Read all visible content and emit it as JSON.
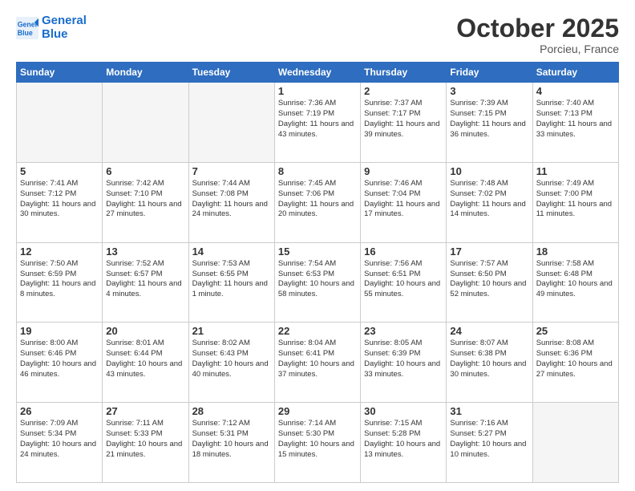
{
  "header": {
    "logo_general": "General",
    "logo_blue": "Blue",
    "month": "October 2025",
    "location": "Porcieu, France"
  },
  "weekdays": [
    "Sunday",
    "Monday",
    "Tuesday",
    "Wednesday",
    "Thursday",
    "Friday",
    "Saturday"
  ],
  "weeks": [
    [
      {
        "day": "",
        "empty": true
      },
      {
        "day": "",
        "empty": true
      },
      {
        "day": "",
        "empty": true
      },
      {
        "day": "1",
        "sunrise": "7:36 AM",
        "sunset": "7:19 PM",
        "daylight": "11 hours and 43 minutes."
      },
      {
        "day": "2",
        "sunrise": "7:37 AM",
        "sunset": "7:17 PM",
        "daylight": "11 hours and 39 minutes."
      },
      {
        "day": "3",
        "sunrise": "7:39 AM",
        "sunset": "7:15 PM",
        "daylight": "11 hours and 36 minutes."
      },
      {
        "day": "4",
        "sunrise": "7:40 AM",
        "sunset": "7:13 PM",
        "daylight": "11 hours and 33 minutes."
      }
    ],
    [
      {
        "day": "5",
        "sunrise": "7:41 AM",
        "sunset": "7:12 PM",
        "daylight": "11 hours and 30 minutes."
      },
      {
        "day": "6",
        "sunrise": "7:42 AM",
        "sunset": "7:10 PM",
        "daylight": "11 hours and 27 minutes."
      },
      {
        "day": "7",
        "sunrise": "7:44 AM",
        "sunset": "7:08 PM",
        "daylight": "11 hours and 24 minutes."
      },
      {
        "day": "8",
        "sunrise": "7:45 AM",
        "sunset": "7:06 PM",
        "daylight": "11 hours and 20 minutes."
      },
      {
        "day": "9",
        "sunrise": "7:46 AM",
        "sunset": "7:04 PM",
        "daylight": "11 hours and 17 minutes."
      },
      {
        "day": "10",
        "sunrise": "7:48 AM",
        "sunset": "7:02 PM",
        "daylight": "11 hours and 14 minutes."
      },
      {
        "day": "11",
        "sunrise": "7:49 AM",
        "sunset": "7:00 PM",
        "daylight": "11 hours and 11 minutes."
      }
    ],
    [
      {
        "day": "12",
        "sunrise": "7:50 AM",
        "sunset": "6:59 PM",
        "daylight": "11 hours and 8 minutes."
      },
      {
        "day": "13",
        "sunrise": "7:52 AM",
        "sunset": "6:57 PM",
        "daylight": "11 hours and 4 minutes."
      },
      {
        "day": "14",
        "sunrise": "7:53 AM",
        "sunset": "6:55 PM",
        "daylight": "11 hours and 1 minute."
      },
      {
        "day": "15",
        "sunrise": "7:54 AM",
        "sunset": "6:53 PM",
        "daylight": "10 hours and 58 minutes."
      },
      {
        "day": "16",
        "sunrise": "7:56 AM",
        "sunset": "6:51 PM",
        "daylight": "10 hours and 55 minutes."
      },
      {
        "day": "17",
        "sunrise": "7:57 AM",
        "sunset": "6:50 PM",
        "daylight": "10 hours and 52 minutes."
      },
      {
        "day": "18",
        "sunrise": "7:58 AM",
        "sunset": "6:48 PM",
        "daylight": "10 hours and 49 minutes."
      }
    ],
    [
      {
        "day": "19",
        "sunrise": "8:00 AM",
        "sunset": "6:46 PM",
        "daylight": "10 hours and 46 minutes."
      },
      {
        "day": "20",
        "sunrise": "8:01 AM",
        "sunset": "6:44 PM",
        "daylight": "10 hours and 43 minutes."
      },
      {
        "day": "21",
        "sunrise": "8:02 AM",
        "sunset": "6:43 PM",
        "daylight": "10 hours and 40 minutes."
      },
      {
        "day": "22",
        "sunrise": "8:04 AM",
        "sunset": "6:41 PM",
        "daylight": "10 hours and 37 minutes."
      },
      {
        "day": "23",
        "sunrise": "8:05 AM",
        "sunset": "6:39 PM",
        "daylight": "10 hours and 33 minutes."
      },
      {
        "day": "24",
        "sunrise": "8:07 AM",
        "sunset": "6:38 PM",
        "daylight": "10 hours and 30 minutes."
      },
      {
        "day": "25",
        "sunrise": "8:08 AM",
        "sunset": "6:36 PM",
        "daylight": "10 hours and 27 minutes."
      }
    ],
    [
      {
        "day": "26",
        "sunrise": "7:09 AM",
        "sunset": "5:34 PM",
        "daylight": "10 hours and 24 minutes."
      },
      {
        "day": "27",
        "sunrise": "7:11 AM",
        "sunset": "5:33 PM",
        "daylight": "10 hours and 21 minutes."
      },
      {
        "day": "28",
        "sunrise": "7:12 AM",
        "sunset": "5:31 PM",
        "daylight": "10 hours and 18 minutes."
      },
      {
        "day": "29",
        "sunrise": "7:14 AM",
        "sunset": "5:30 PM",
        "daylight": "10 hours and 15 minutes."
      },
      {
        "day": "30",
        "sunrise": "7:15 AM",
        "sunset": "5:28 PM",
        "daylight": "10 hours and 13 minutes."
      },
      {
        "day": "31",
        "sunrise": "7:16 AM",
        "sunset": "5:27 PM",
        "daylight": "10 hours and 10 minutes."
      },
      {
        "day": "",
        "empty": true
      }
    ]
  ]
}
